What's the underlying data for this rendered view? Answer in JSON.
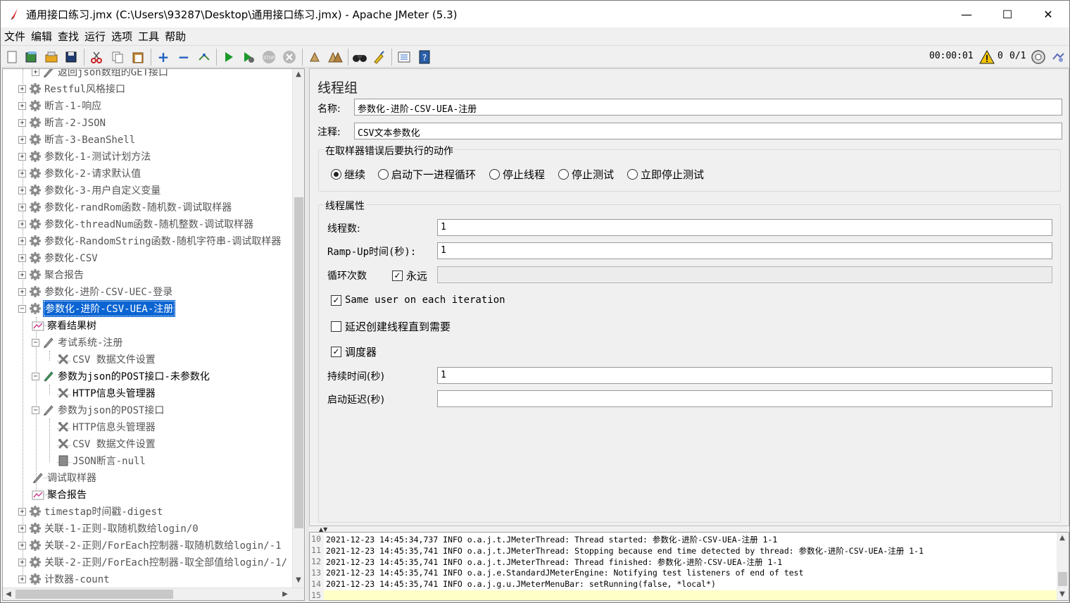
{
  "window": {
    "title": "通用接口练习.jmx (C:\\Users\\93287\\Desktop\\通用接口练习.jmx) - Apache JMeter (5.3)",
    "minimize": "—",
    "maximize": "☐",
    "close": "✕"
  },
  "menu": [
    "文件",
    "编辑",
    "查找",
    "运行",
    "选项",
    "工具",
    "帮助"
  ],
  "toolbar_status": {
    "timer": "00:00:01",
    "warnings": "0",
    "threads": "0/1"
  },
  "tree": {
    "items": [
      {
        "label": "返回json数组的GET接口",
        "level": 1,
        "icon": "pencil-icon",
        "dim": true
      },
      {
        "label": "Restful风格接口",
        "level": 0,
        "icon": "gear-icon",
        "dim": true
      },
      {
        "label": "断言-1-响应",
        "level": 0,
        "icon": "gear-icon",
        "dim": true
      },
      {
        "label": "断言-2-JSON",
        "level": 0,
        "icon": "gear-icon",
        "dim": true
      },
      {
        "label": "断言-3-BeanShell",
        "level": 0,
        "icon": "gear-icon",
        "dim": true
      },
      {
        "label": "参数化-1-测试计划方法",
        "level": 0,
        "icon": "gear-icon",
        "dim": true
      },
      {
        "label": "参数化-2-请求默认值",
        "level": 0,
        "icon": "gear-icon",
        "dim": true
      },
      {
        "label": "参数化-3-用户自定义变量",
        "level": 0,
        "icon": "gear-icon",
        "dim": true
      },
      {
        "label": "参数化-randRom函数-随机数-调试取样器",
        "level": 0,
        "icon": "gear-icon",
        "dim": true
      },
      {
        "label": "参数化-threadNum函数-随机整数-调试取样器",
        "level": 0,
        "icon": "gear-icon",
        "dim": true
      },
      {
        "label": "参数化-RandomString函数-随机字符串-调试取样器",
        "level": 0,
        "icon": "gear-icon",
        "dim": true
      },
      {
        "label": "参数化-CSV",
        "level": 0,
        "icon": "gear-icon",
        "dim": true
      },
      {
        "label": "聚合报告",
        "level": 0,
        "icon": "gear-icon",
        "dim": true
      },
      {
        "label": "参数化-进阶-CSV-UEC-登录",
        "level": 0,
        "icon": "gear-icon",
        "dim": true
      },
      {
        "label": "参数化-进阶-CSV-UEA-注册",
        "level": 0,
        "icon": "gear-icon",
        "selected": true
      },
      {
        "label": "察看结果树",
        "level": 1,
        "icon": "chart-icon"
      },
      {
        "label": "考试系统-注册",
        "level": 1,
        "icon": "pencil-icon",
        "dim": true
      },
      {
        "label": "CSV 数据文件设置",
        "level": 2,
        "icon": "wrench-icon",
        "dim": true
      },
      {
        "label": "参数为json的POST接口-未参数化",
        "level": 1,
        "icon": "pencil-icon"
      },
      {
        "label": "HTTP信息头管理器",
        "level": 2,
        "icon": "wrench-icon"
      },
      {
        "label": "参数为json的POST接口",
        "level": 1,
        "icon": "pencil-icon",
        "dim": true
      },
      {
        "label": "HTTP信息头管理器",
        "level": 2,
        "icon": "wrench-icon",
        "dim": true
      },
      {
        "label": "CSV 数据文件设置",
        "level": 2,
        "icon": "wrench-icon",
        "dim": true
      },
      {
        "label": "JSON断言-null",
        "level": 2,
        "icon": "assert-icon",
        "dim": true
      },
      {
        "label": "调试取样器",
        "level": 1,
        "icon": "pencil-icon",
        "dim": true
      },
      {
        "label": "聚合报告",
        "level": 1,
        "icon": "chart-icon"
      },
      {
        "label": "timestap时间戳-digest",
        "level": 0,
        "icon": "gear-icon",
        "dim": true
      },
      {
        "label": "关联-1-正则-取随机数给login/0",
        "level": 0,
        "icon": "gear-icon",
        "dim": true
      },
      {
        "label": "关联-2-正则/ForEach控制器-取随机数给login/-1",
        "level": 0,
        "icon": "gear-icon",
        "dim": true
      },
      {
        "label": "关联-2-正则/ForEach控制器-取全部值给login/-1/",
        "level": 0,
        "icon": "gear-icon",
        "dim": true
      },
      {
        "label": "计数器-count",
        "level": 0,
        "icon": "gear-icon",
        "dim": true
      }
    ]
  },
  "panel": {
    "title": "线程组",
    "name_label": "名称:",
    "name_value": "参数化-进阶-CSV-UEA-注册",
    "comment_label": "注释:",
    "comment_value": "CSV文本参数化",
    "error_action_title": "在取样器错误后要执行的动作",
    "error_actions": [
      {
        "label": "继续",
        "checked": true
      },
      {
        "label": "启动下一进程循环",
        "checked": false
      },
      {
        "label": "停止线程",
        "checked": false
      },
      {
        "label": "停止测试",
        "checked": false
      },
      {
        "label": "立即停止测试",
        "checked": false
      }
    ],
    "thread_props_title": "线程属性",
    "threads_label": "线程数:",
    "threads_value": "1",
    "rampup_label": "Ramp-Up时间(秒):",
    "rampup_value": "1",
    "loop_label": "循环次数",
    "forever_label": "永远",
    "loop_value": "",
    "same_user_label": "Same user on each iteration",
    "delay_create_label": "延迟创建线程直到需要",
    "scheduler_label": "调度器",
    "duration_label": "持续时间(秒)",
    "duration_value": "1",
    "startup_delay_label": "启动延迟(秒)",
    "startup_delay_value": ""
  },
  "log": {
    "lines": [
      {
        "n": "10",
        "text": "2021-12-23 14:45:34,737 INFO o.a.j.t.JMeterThread: Thread started: 参数化-进阶-CSV-UEA-注册 1-1"
      },
      {
        "n": "11",
        "text": "2021-12-23 14:45:35,741 INFO o.a.j.t.JMeterThread: Stopping because end time detected by thread: 参数化-进阶-CSV-UEA-注册 1-1"
      },
      {
        "n": "12",
        "text": "2021-12-23 14:45:35,741 INFO o.a.j.t.JMeterThread: Thread finished: 参数化-进阶-CSV-UEA-注册 1-1"
      },
      {
        "n": "13",
        "text": "2021-12-23 14:45:35,741 INFO o.a.j.e.StandardJMeterEngine: Notifying test listeners of end of test"
      },
      {
        "n": "14",
        "text": "2021-12-23 14:45:35,741 INFO o.a.j.g.u.JMeterMenuBar: setRunning(false, *local*)"
      },
      {
        "n": "15",
        "text": ""
      }
    ]
  }
}
